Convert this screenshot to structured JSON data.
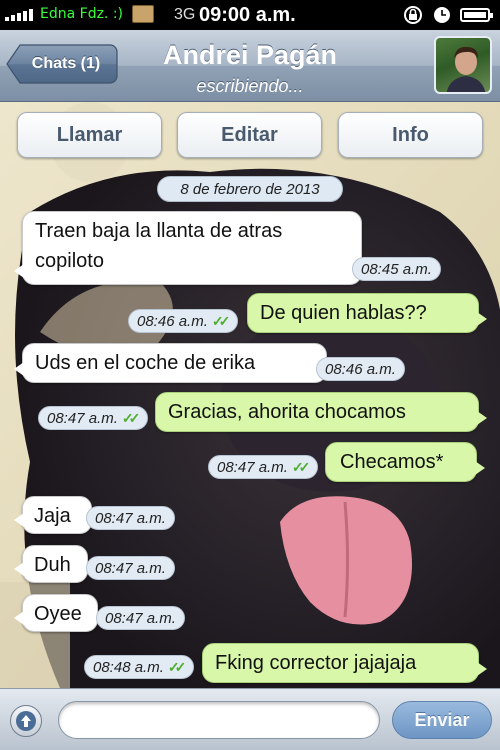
{
  "status_bar": {
    "carrier": "Edna Fdz. :)",
    "network": "3G",
    "time": "09:00 a.m."
  },
  "nav": {
    "back_label": "Chats (1)",
    "contact_name": "Andrei Pagán",
    "contact_status": "escribiendo..."
  },
  "actions": {
    "call": "Llamar",
    "edit": "Editar",
    "info": "Info"
  },
  "conversation": {
    "date": "8 de febrero de 2013",
    "messages": [
      {
        "direction": "in",
        "lines": [
          "Traen baja la llanta de atras",
          "copiloto"
        ],
        "time": "08:45 a.m."
      },
      {
        "direction": "out",
        "text": "De quien hablas??",
        "time": "08:46 a.m.",
        "delivered": true
      },
      {
        "direction": "in",
        "text": "Uds en el coche de erika",
        "time": "08:46 a.m."
      },
      {
        "direction": "out",
        "text": "Gracias, ahorita chocamos",
        "time": "08:47 a.m.",
        "delivered": true
      },
      {
        "direction": "out",
        "text": "Checamos*",
        "time": "08:47 a.m.",
        "delivered": true
      },
      {
        "direction": "in",
        "text": "Jaja",
        "time": "08:47 a.m."
      },
      {
        "direction": "in",
        "text": "Duh",
        "time": "08:47 a.m."
      },
      {
        "direction": "in",
        "text": "Oyee",
        "time": "08:47 a.m."
      },
      {
        "direction": "out",
        "text": "Fking corrector jajajaja",
        "time": "08:48 a.m.",
        "delivered": true
      }
    ]
  },
  "composer": {
    "input_value": "",
    "send_label": "Enviar"
  },
  "colors": {
    "outgoing_bubble": "#d8f7a8",
    "incoming_bubble": "#ffffff",
    "nav_bar": "#91a2b6",
    "read_ticks": "#4fae2d"
  }
}
